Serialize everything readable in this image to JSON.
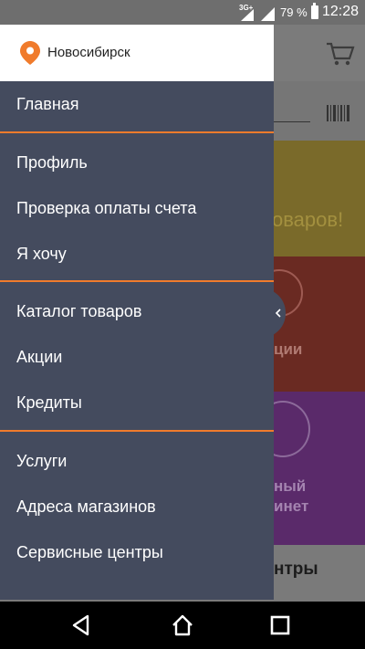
{
  "status_bar": {
    "network": "3G+",
    "battery_percent": "79 %",
    "time": "12:28",
    "icons": [
      "signal-icon",
      "signal-icon",
      "battery-icon"
    ]
  },
  "background_app": {
    "yellow_tile_text": "оваров!",
    "red_tile_text": "ции",
    "purple_tile_text_1": "ный",
    "purple_tile_text_2": "инет",
    "bottom_tile_text": "нтры",
    "icons": [
      "cart-icon",
      "barcode-icon"
    ]
  },
  "drawer": {
    "city": "Новосибирск",
    "city_icon": "location-pin-icon",
    "accent_color": "#f07b2c",
    "background_color": "#444b5e",
    "groups": [
      {
        "items": [
          "Главная"
        ]
      },
      {
        "items": [
          "Профиль",
          "Проверка оплаты счета",
          "Я хочу"
        ]
      },
      {
        "items": [
          "Каталог товаров",
          "Акции",
          "Кредиты"
        ]
      },
      {
        "items": [
          "Услуги",
          "Адреса магазинов",
          "Сервисные центры"
        ]
      }
    ],
    "tab_icon": "chevron-left-icon"
  },
  "nav_bar": {
    "icons": [
      "back-icon",
      "home-icon",
      "recents-icon"
    ]
  }
}
